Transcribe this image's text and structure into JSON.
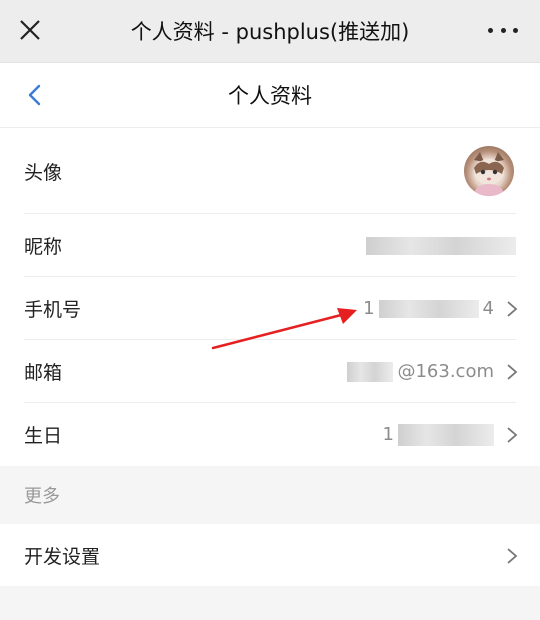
{
  "window": {
    "title": "个人资料 - pushplus(推送加)"
  },
  "navbar": {
    "title": "个人资料"
  },
  "rows": {
    "avatar": {
      "label": "头像"
    },
    "nickname": {
      "label": "昵称"
    },
    "phone": {
      "label": "手机号",
      "prefix": "1",
      "suffix": "4"
    },
    "email": {
      "label": "邮箱",
      "suffix": "@163.com"
    },
    "birthday": {
      "label": "生日",
      "prefix": "1"
    }
  },
  "more": {
    "header": "更多",
    "dev_settings": {
      "label": "开发设置"
    }
  },
  "icons": {
    "close": "close-icon",
    "more": "more-icon",
    "back": "back-chevron-icon",
    "chevron": "chevron-right-icon"
  },
  "colors": {
    "accent": "#3a7bd5",
    "annotation_arrow": "#e62020",
    "secondary_text": "#8c8c8c"
  }
}
